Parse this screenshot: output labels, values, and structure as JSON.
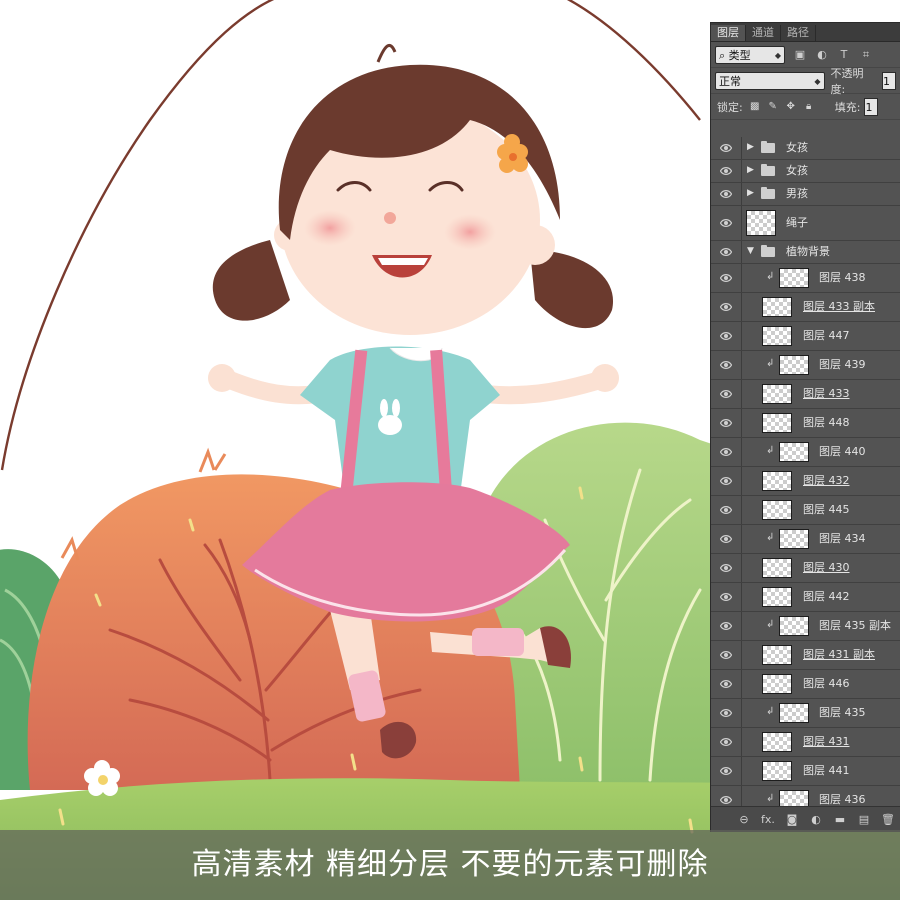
{
  "caption": "高清素材  精细分层  不要的元素可删除",
  "panel": {
    "tabs": [
      "图层",
      "通道",
      "路径"
    ],
    "filter": {
      "kind_label": "类型",
      "icons": [
        "image-filter-icon",
        "adjustment-filter-icon",
        "type-filter-icon",
        "shape-filter-icon"
      ]
    },
    "blend_mode": "正常",
    "opacity_label": "不透明度:",
    "opacity_value": "1",
    "lock_label": "锁定:",
    "fill_label": "填充:",
    "fill_value": "1",
    "layers": [
      {
        "kind": "group",
        "collapsed": true,
        "name": "女孩"
      },
      {
        "kind": "group",
        "collapsed": true,
        "name": "女孩"
      },
      {
        "kind": "group",
        "collapsed": true,
        "name": "男孩"
      },
      {
        "kind": "smart",
        "name": "绳子"
      },
      {
        "kind": "group",
        "collapsed": false,
        "name": "植物背景"
      },
      {
        "kind": "layer",
        "clipped": true,
        "name": "图层 438"
      },
      {
        "kind": "layer",
        "clipped": false,
        "name": "图层 433 副本"
      },
      {
        "kind": "layer",
        "clipped": false,
        "name": "图层 447"
      },
      {
        "kind": "layer",
        "clipped": true,
        "name": "图层 439"
      },
      {
        "kind": "layer",
        "clipped": false,
        "name": "图层 433"
      },
      {
        "kind": "layer",
        "clipped": false,
        "name": "图层 448"
      },
      {
        "kind": "layer",
        "clipped": true,
        "name": "图层 440"
      },
      {
        "kind": "layer",
        "clipped": false,
        "name": "图层 432"
      },
      {
        "kind": "layer",
        "clipped": false,
        "name": "图层 445"
      },
      {
        "kind": "layer",
        "clipped": true,
        "name": "图层 434"
      },
      {
        "kind": "layer",
        "clipped": false,
        "name": "图层 430"
      },
      {
        "kind": "layer",
        "clipped": false,
        "name": "图层 442"
      },
      {
        "kind": "layer",
        "clipped": true,
        "name": "图层 435 副本"
      },
      {
        "kind": "layer",
        "clipped": false,
        "name": "图层 431 副本"
      },
      {
        "kind": "layer",
        "clipped": false,
        "name": "图层 446"
      },
      {
        "kind": "layer",
        "clipped": true,
        "name": "图层 435"
      },
      {
        "kind": "layer",
        "clipped": false,
        "name": "图层 431"
      },
      {
        "kind": "layer",
        "clipped": false,
        "name": "图层 441"
      },
      {
        "kind": "layer",
        "clipped": true,
        "name": "图层 436"
      }
    ],
    "bottom_icons": [
      "link-icon",
      "fx-icon",
      "mask-icon",
      "adjustment-icon",
      "new-group-icon",
      "new-layer-icon",
      "trash-icon"
    ],
    "bottom_fx": "fx."
  },
  "colors": {
    "panel_bg": "#535353",
    "rope": "#7a3b2e",
    "skirt": "#e47a9c",
    "shirt": "#8fd3cf",
    "hair": "#6b3a2e",
    "bush_orange": "#e7875a",
    "bush_green": "#9cc56f",
    "grass": "#a9cf6d"
  }
}
